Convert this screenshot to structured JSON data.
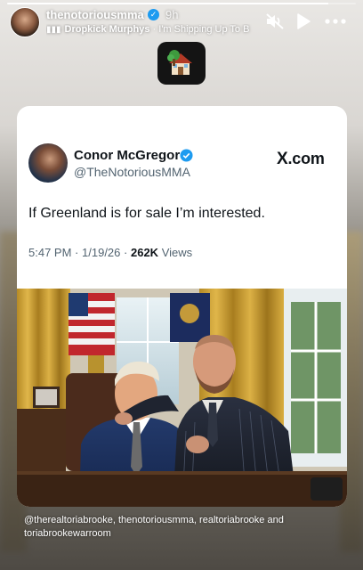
{
  "story": {
    "progress_fraction": 0.92,
    "username": "thenotoriousmma",
    "time_ago": "9h",
    "music": {
      "artist": "Dropkick Murphys",
      "separator": " · ",
      "song": "I'm Shipping Up To B"
    },
    "icons": {
      "mute": "speaker-muted-icon",
      "play": "play-icon",
      "more": "more-options-icon",
      "verified": "verified-badge-icon",
      "music": "music-bars-icon"
    }
  },
  "sticker": {
    "icon": "house-with-tree-emoji"
  },
  "tweet": {
    "name": "Conor McGregor",
    "handle": "@TheNotoriousMMA",
    "source": ".com",
    "source_logo_letter": "X",
    "text": "If Greenland is for sale I’m interested.",
    "time": "5:47 PM",
    "date": "1/19/26",
    "dot": "·",
    "views_count": "262K",
    "views_label": "Views",
    "verified_color": "#1d9bf0"
  },
  "mentions": {
    "text": "@therealtoriabrooke, thenotoriousmma, realtoriabrooke and toriabrookewarroom"
  }
}
